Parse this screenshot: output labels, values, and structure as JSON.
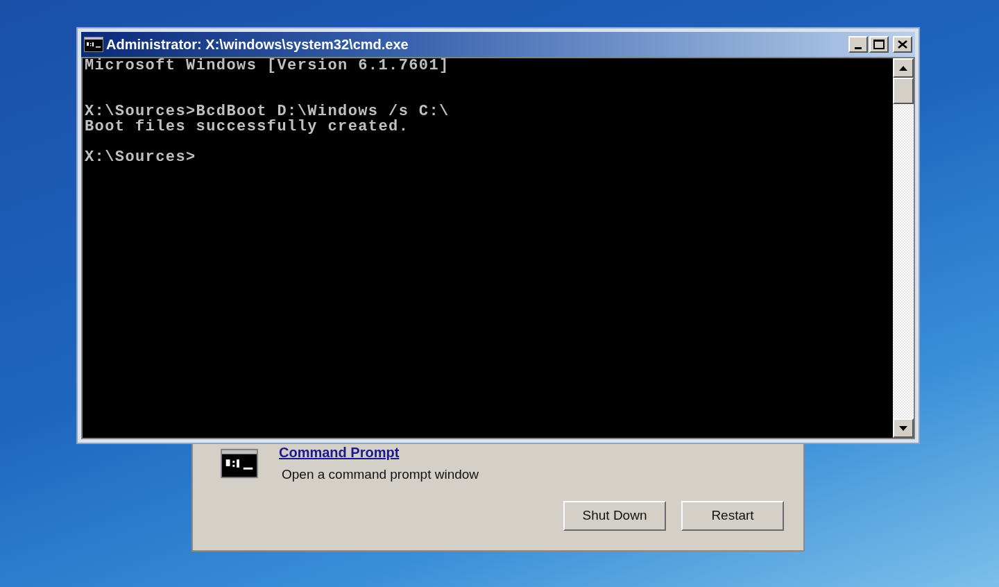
{
  "console_window": {
    "title": "Administrator: X:\\windows\\system32\\cmd.exe",
    "output": "Microsoft Windows [Version 6.1.7601]\n\n\nX:\\Sources>BcdBoot D:\\Windows /s C:\\\nBoot files successfully created.\n\nX:\\Sources>"
  },
  "recovery_dialog": {
    "tool": {
      "title": "Command Prompt",
      "description": "Open a command prompt window"
    },
    "buttons": [
      "Shut Down",
      "Restart"
    ]
  }
}
